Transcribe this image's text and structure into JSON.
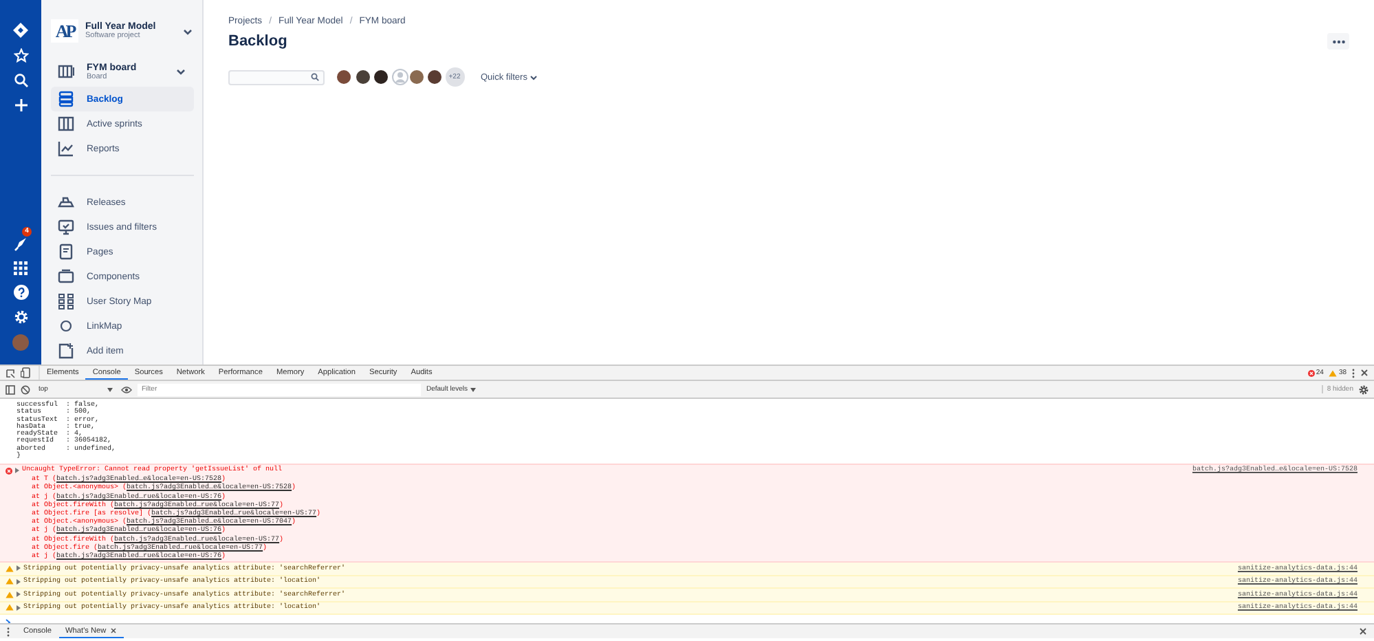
{
  "nav_rail": {
    "notification_count": "4"
  },
  "project": {
    "logo_text": "AP",
    "name": "Full Year Model",
    "type": "Software project"
  },
  "board": {
    "name": "FYM board",
    "type": "Board"
  },
  "sidebar_groups": [
    [
      {
        "label": "Backlog",
        "selected": true
      },
      {
        "label": "Active sprints",
        "selected": false
      },
      {
        "label": "Reports",
        "selected": false
      }
    ],
    [
      {
        "label": "Releases",
        "selected": false
      },
      {
        "label": "Issues and filters",
        "selected": false
      },
      {
        "label": "Pages",
        "selected": false
      },
      {
        "label": "Components",
        "selected": false
      },
      {
        "label": "User Story Map",
        "selected": false
      },
      {
        "label": "LinkMap",
        "selected": false
      },
      {
        "label": "Add item",
        "selected": false
      }
    ]
  ],
  "breadcrumbs": [
    {
      "kind": "link",
      "text": "Projects"
    },
    {
      "kind": "separator",
      "text": "/"
    },
    {
      "kind": "link",
      "text": "Full Year Model"
    },
    {
      "kind": "separator",
      "text": "/"
    },
    {
      "kind": "link",
      "text": "FYM board"
    }
  ],
  "page_title": "Backlog",
  "avatars": [
    {
      "kind": "photo"
    },
    {
      "kind": "photo"
    },
    {
      "kind": "photo"
    },
    {
      "kind": "default"
    },
    {
      "kind": "photo"
    },
    {
      "kind": "photo"
    }
  ],
  "more_count": "+22",
  "quick_filters": "Quick filters",
  "devtools": {
    "tabs": [
      {
        "label": "Elements",
        "selected": false
      },
      {
        "label": "Console",
        "selected": true
      },
      {
        "label": "Sources",
        "selected": false
      },
      {
        "label": "Network",
        "selected": false
      },
      {
        "label": "Performance",
        "selected": false
      },
      {
        "label": "Memory",
        "selected": false
      },
      {
        "label": "Application",
        "selected": false
      },
      {
        "label": "Security",
        "selected": false
      },
      {
        "label": "Audits",
        "selected": false
      }
    ],
    "error_count": "24",
    "warning_count": "38",
    "context": "top",
    "filter_placeholder": "Filter",
    "levels": "Default levels",
    "hidden": "8 hidden",
    "object_lines": [
      "successful  : false,",
      "status      : 500,",
      "statusText  : error,",
      "hasData     : true,",
      "readyState  : 4,",
      "requestId   : 36054182,",
      "aborted     : undefined,",
      "}"
    ],
    "error": {
      "message": "Uncaught TypeError: Cannot read property 'getIssueList' of null",
      "source": "batch.js?adg3Enabled…e&locale=en-US:7528",
      "frames": [
        {
          "caller": "at T (",
          "link": "batch.js?adg3Enabled…e&locale=en-US:7528",
          "close": ")"
        },
        {
          "caller": "at Object.<anonymous> (",
          "link": "batch.js?adg3Enabled…e&locale=en-US:7528",
          "close": ")"
        },
        {
          "caller": "at j (",
          "link": "batch.js?adg3Enabled…rue&locale=en-US:76",
          "close": ")"
        },
        {
          "caller": "at Object.fireWith (",
          "link": "batch.js?adg3Enabled…rue&locale=en-US:77",
          "close": ")"
        },
        {
          "caller": "at Object.fire [as resolve] (",
          "link": "batch.js?adg3Enabled…rue&locale=en-US:77",
          "close": ")"
        },
        {
          "caller": "at Object.<anonymous> (",
          "link": "batch.js?adg3Enabled…e&locale=en-US:7047",
          "close": ")"
        },
        {
          "caller": "at j (",
          "link": "batch.js?adg3Enabled…rue&locale=en-US:76",
          "close": ")"
        },
        {
          "caller": "at Object.fireWith (",
          "link": "batch.js?adg3Enabled…rue&locale=en-US:77",
          "close": ")"
        },
        {
          "caller": "at Object.fire (",
          "link": "batch.js?adg3Enabled…rue&locale=en-US:77",
          "close": ")"
        },
        {
          "caller": "at j (",
          "link": "batch.js?adg3Enabled…rue&locale=en-US:76",
          "close": ")"
        }
      ]
    },
    "warnings": [
      {
        "message": "Stripping out potentially privacy-unsafe analytics attribute: 'searchReferrer'",
        "source": "sanitize-analytics-data.js:44"
      },
      {
        "message": "Stripping out potentially privacy-unsafe analytics attribute: 'location'",
        "source": "sanitize-analytics-data.js:44"
      },
      {
        "message": "Stripping out potentially privacy-unsafe analytics attribute: 'searchReferrer'",
        "source": "sanitize-analytics-data.js:44"
      },
      {
        "message": "Stripping out potentially privacy-unsafe analytics attribute: 'location'",
        "source": "sanitize-analytics-data.js:44"
      }
    ],
    "drawer_tabs": [
      {
        "label": "Console",
        "selected": false,
        "closable": false
      },
      {
        "label": "What's New",
        "selected": true,
        "closable": true
      }
    ]
  }
}
